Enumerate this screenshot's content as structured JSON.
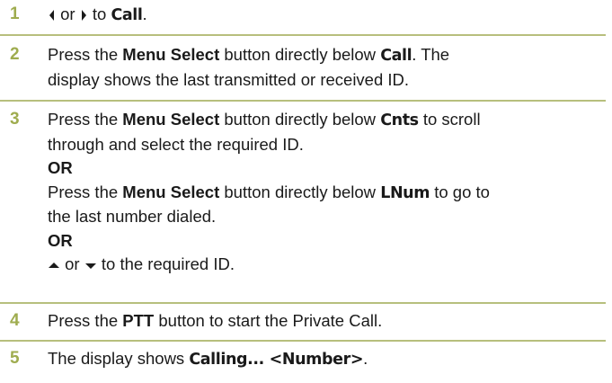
{
  "steps": [
    {
      "number": "1",
      "or_text": "or",
      "to_text": "to",
      "target": "Call",
      "end": "."
    },
    {
      "number": "2",
      "press": "Press the",
      "button": "Menu Select",
      "mid": "button directly below",
      "target": "Call",
      "after": ". The",
      "line2": "display shows the last transmitted or received ID."
    },
    {
      "number": "3",
      "a_press": "Press the",
      "a_button": "Menu Select",
      "a_mid": "button directly below",
      "a_target": "Cnts",
      "a_after": "to scroll",
      "a_line2": "through and select the required ID.",
      "or1": "OR",
      "b_press": "Press the",
      "b_button": "Menu Select",
      "b_mid": "button directly below",
      "b_target": "LNum",
      "b_after": "to go to",
      "b_line2": "the last number dialed.",
      "or2": "OR",
      "c_or": "or",
      "c_rest": "to the required ID."
    },
    {
      "number": "4",
      "press": "Press the",
      "button": "PTT",
      "rest": "button to start the Private Call."
    },
    {
      "number": "5",
      "lead": "The display shows",
      "display": "Calling... <Number>",
      "end": "."
    }
  ],
  "colors": {
    "step_number": "#9fac4f",
    "rule": "#b7bf7d",
    "text": "#1a1a1a"
  },
  "icons": [
    "left-arrow-icon",
    "right-arrow-icon",
    "up-arrow-icon",
    "down-arrow-icon"
  ]
}
